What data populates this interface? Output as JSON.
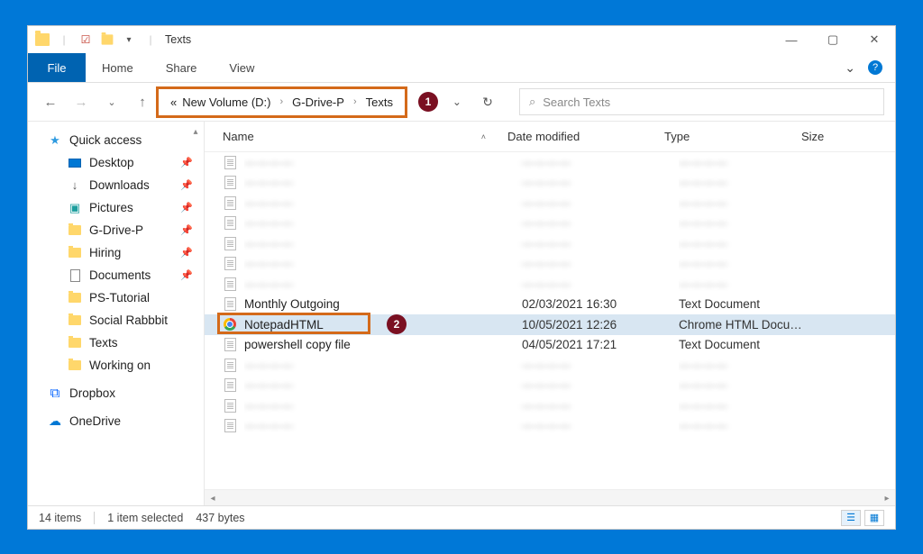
{
  "window": {
    "title": "Texts"
  },
  "ribbon": {
    "file": "File",
    "tabs": [
      "Home",
      "Share",
      "View"
    ]
  },
  "breadcrumb": {
    "overflow": "«",
    "parts": [
      "New Volume (D:)",
      "G-Drive-P",
      "Texts"
    ]
  },
  "callouts": {
    "breadcrumb": "1",
    "file": "2"
  },
  "search": {
    "placeholder": "Search Texts"
  },
  "sidebar": {
    "quick_access": "Quick access",
    "items": [
      {
        "label": "Desktop",
        "icon": "desktop",
        "pinned": true
      },
      {
        "label": "Downloads",
        "icon": "download",
        "pinned": true
      },
      {
        "label": "Pictures",
        "icon": "pictures",
        "pinned": true
      },
      {
        "label": "G-Drive-P",
        "icon": "folder",
        "pinned": true
      },
      {
        "label": "Hiring",
        "icon": "folder",
        "pinned": true
      },
      {
        "label": "Documents",
        "icon": "doc",
        "pinned": true
      },
      {
        "label": "PS-Tutorial",
        "icon": "folder",
        "pinned": false
      },
      {
        "label": "Social Rabbbit",
        "icon": "folder",
        "pinned": false
      },
      {
        "label": "Texts",
        "icon": "folder",
        "pinned": false
      },
      {
        "label": "Working on",
        "icon": "folder",
        "pinned": false
      }
    ],
    "dropbox": "Dropbox",
    "onedrive": "OneDrive"
  },
  "columns": {
    "name": "Name",
    "date": "Date modified",
    "type": "Type",
    "size": "Size"
  },
  "files": [
    {
      "name": "————",
      "date": "————",
      "type": "————",
      "blurred": true,
      "icon": "txt"
    },
    {
      "name": "————",
      "date": "————",
      "type": "————",
      "blurred": true,
      "icon": "txt"
    },
    {
      "name": "————",
      "date": "————",
      "type": "————",
      "blurred": true,
      "icon": "txt"
    },
    {
      "name": "————",
      "date": "————",
      "type": "————",
      "blurred": true,
      "icon": "txt"
    },
    {
      "name": "————",
      "date": "————",
      "type": "————",
      "blurred": true,
      "icon": "txt"
    },
    {
      "name": "————",
      "date": "————",
      "type": "————",
      "blurred": true,
      "icon": "txt"
    },
    {
      "name": "————",
      "date": "————",
      "type": "————",
      "blurred": true,
      "icon": "txt"
    },
    {
      "name": "Monthly Outgoing",
      "date": "02/03/2021 16:30",
      "type": "Text Document",
      "blurred": false,
      "icon": "txt"
    },
    {
      "name": "NotepadHTML",
      "date": "10/05/2021 12:26",
      "type": "Chrome HTML Docu…",
      "blurred": false,
      "icon": "chrome",
      "selected": true,
      "highlighted": true
    },
    {
      "name": "powershell copy file",
      "date": "04/05/2021 17:21",
      "type": "Text Document",
      "blurred": false,
      "icon": "txt"
    },
    {
      "name": "————",
      "date": "————",
      "type": "————",
      "blurred": true,
      "icon": "txt"
    },
    {
      "name": "————",
      "date": "————",
      "type": "————",
      "blurred": true,
      "icon": "txt"
    },
    {
      "name": "————",
      "date": "————",
      "type": "————",
      "blurred": true,
      "icon": "txt"
    },
    {
      "name": "————",
      "date": "————",
      "type": "————",
      "blurred": true,
      "icon": "txt"
    }
  ],
  "status": {
    "items": "14 items",
    "selected": "1 item selected",
    "size": "437 bytes"
  }
}
